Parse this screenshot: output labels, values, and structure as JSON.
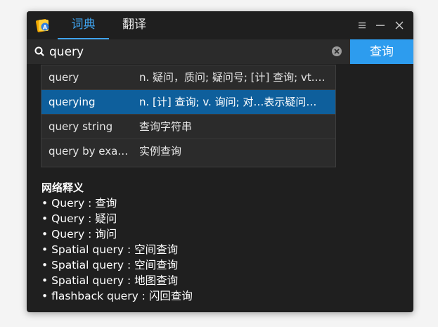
{
  "header": {
    "tabs": [
      {
        "label": "词典",
        "active": true
      },
      {
        "label": "翻译",
        "active": false
      }
    ]
  },
  "search": {
    "value": "query",
    "button_label": "查询"
  },
  "suggestions": [
    {
      "word": "query",
      "definition": "n. 疑问，质问; 疑问号; [计] 查询; vt. ..."
    },
    {
      "word": "querying",
      "definition": "n. [计] 查询; v. 询问; 对…表示疑问（..."
    },
    {
      "word": "query string",
      "definition": "查询字符串"
    },
    {
      "word": "query by exam...",
      "definition": "实例查询"
    }
  ],
  "web_definitions": {
    "title": "网络释义",
    "items": [
      "• Query : 查询",
      "• Query : 疑问",
      "• Query : 询问",
      "• Spatial query : 空间查询",
      "• Spatial query : 空间查询",
      "• Spatial query : 地图查询",
      "• flashback query : 闪回查询"
    ]
  },
  "colors": {
    "accent": "#2d9cee",
    "selected_row": "#0e5f9c",
    "background": "#1f1f1f"
  },
  "icons": [
    "app-logo-icon",
    "menu-icon",
    "minimize-icon",
    "close-icon",
    "search-icon",
    "clear-icon"
  ]
}
